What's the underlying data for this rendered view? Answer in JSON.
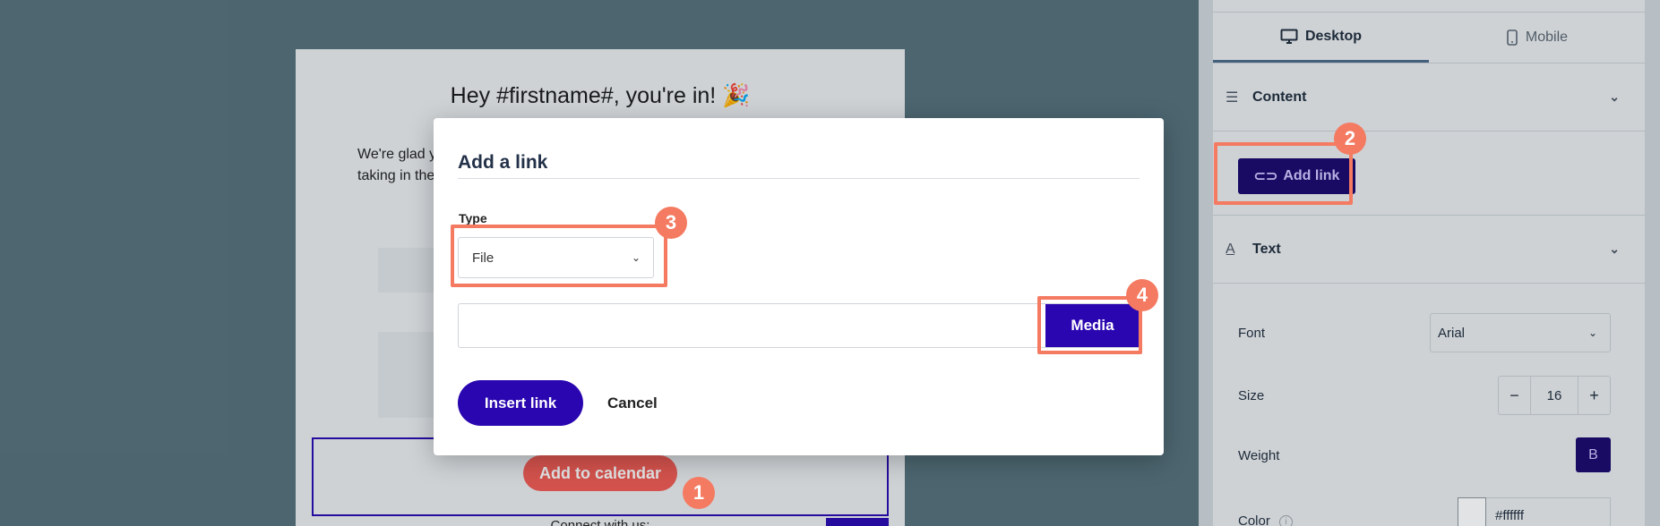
{
  "email": {
    "heading": "Hey #firstname#, you're in! 🎉",
    "body_line_1": "We're glad y",
    "body_line_2": "taking in the",
    "add_to_calendar": "Add to calendar",
    "connect_text": "Connect with us:"
  },
  "panel": {
    "tabs": [
      {
        "label": "Desktop",
        "icon": "monitor-icon",
        "active": true
      },
      {
        "label": "Mobile",
        "icon": "phone-icon",
        "active": false
      }
    ],
    "content_section": {
      "label": "Content"
    },
    "add_link_label": "Add link",
    "text_section": {
      "label": "Text"
    },
    "font": {
      "label": "Font",
      "value": "Arial"
    },
    "size": {
      "label": "Size",
      "value": "16",
      "minus": "−",
      "plus": "+"
    },
    "weight": {
      "label": "Weight",
      "bold_label": "B"
    },
    "color": {
      "label": "Color",
      "value": "#ffffff"
    }
  },
  "modal": {
    "title": "Add a link",
    "type_label": "Type",
    "type_value": "File",
    "url_value": "",
    "media_label": "Media",
    "insert_label": "Insert link",
    "cancel_label": "Cancel"
  },
  "annotations": {
    "badge_1": "1",
    "badge_2": "2",
    "badge_3": "3",
    "badge_4": "4",
    "color": "#f47a61"
  },
  "colors": {
    "primary": "#2a06b0",
    "calendar_button": "#ee5a54",
    "backdrop": "#55707a"
  }
}
